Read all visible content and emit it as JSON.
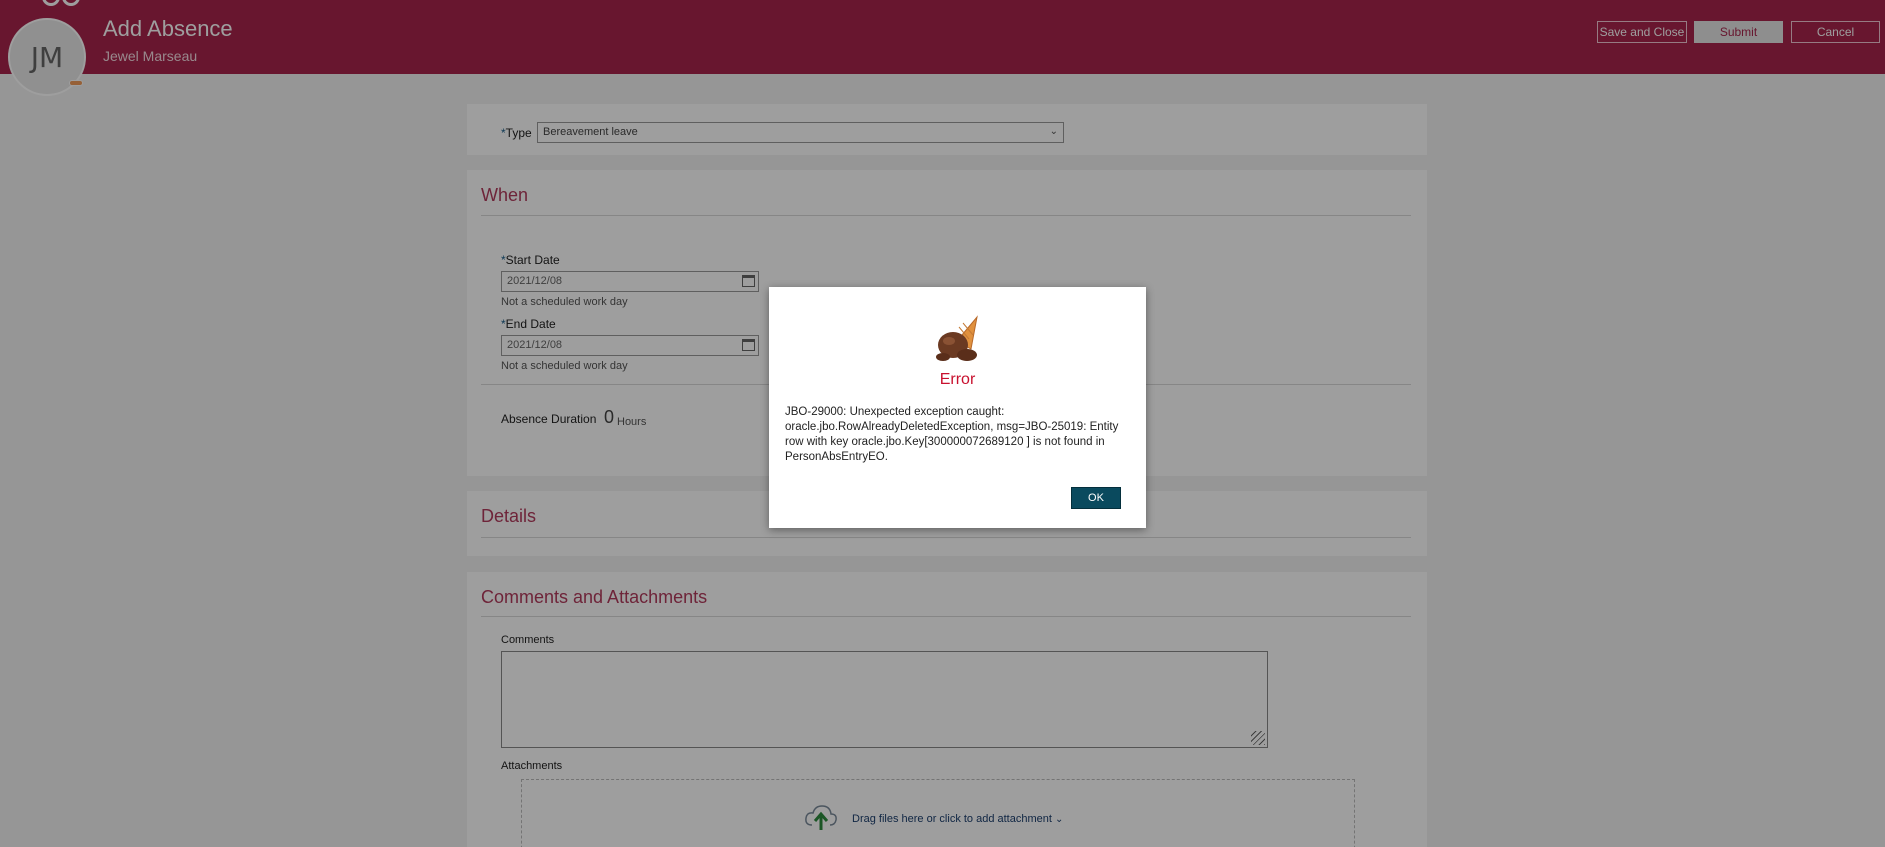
{
  "header": {
    "title": "Add Absence",
    "subtitle": "Jewel Marseau",
    "avatar_initials": "JM",
    "buttons": {
      "save_close": "Save and Close",
      "submit": "Submit",
      "cancel": "Cancel"
    }
  },
  "form": {
    "type_label": "Type",
    "type_value": "Bereavement leave",
    "when_section": "When",
    "start_date_label": "Start Date",
    "start_date_value": "2021/12/08",
    "start_date_hint": "Not a scheduled work day",
    "end_date_label": "End Date",
    "end_date_value": "2021/12/08",
    "end_date_hint": "Not a scheduled work day",
    "duration_label": "Absence Duration",
    "duration_value": "0",
    "duration_unit": "Hours",
    "details_section": "Details",
    "comments_section": "Comments and Attachments",
    "comments_label": "Comments",
    "comments_value": "",
    "attachments_label": "Attachments",
    "dropzone_text": "Drag files here or click to add attachment"
  },
  "dialog": {
    "title": "Error",
    "message": "JBO-29000: Unexpected exception caught: oracle.jbo.RowAlreadyDeletedException, msg=JBO-25019: Entity row with key oracle.jbo.Key[300000072689120 ] is not found in PersonAbsEntryEO.",
    "ok_label": "OK"
  },
  "colors": {
    "header": "#a8244c",
    "section_title": "#b23a5c",
    "error": "#c8102e",
    "ok_button": "#0a4a5e"
  }
}
